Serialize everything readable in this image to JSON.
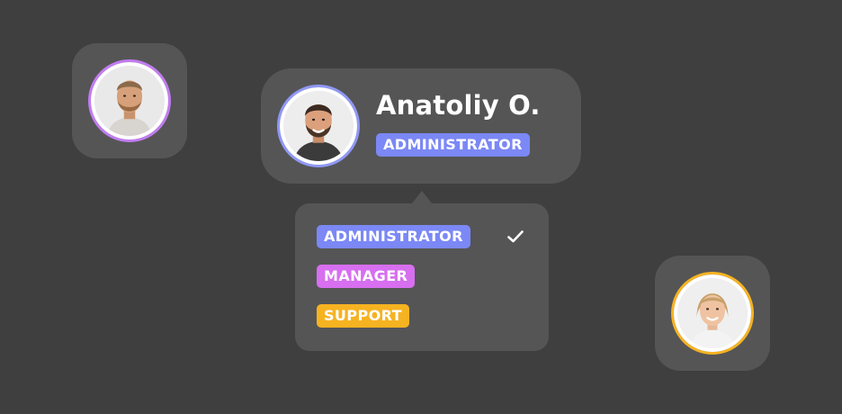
{
  "profile": {
    "name": "Anatoliy O.",
    "role": "ADMINISTRATOR"
  },
  "role_menu": {
    "options": [
      {
        "label": "ADMINISTRATOR",
        "color": "#7b88f5",
        "selected": true
      },
      {
        "label": "MANAGER",
        "color": "#d76ff0",
        "selected": false
      },
      {
        "label": "SUPPORT",
        "color": "#f6b321",
        "selected": false
      }
    ],
    "check_icon": "check-icon"
  },
  "avatars": [
    {
      "name": "avatar-man-beard",
      "ring_color": "#c27cf0"
    },
    {
      "name": "avatar-man-smiling",
      "ring_color": "#8f98f6"
    },
    {
      "name": "avatar-woman-smiling",
      "ring_color": "#f6b321"
    }
  ],
  "colors": {
    "background": "#3f3f40",
    "card": "#555556",
    "administrator": "#7b88f5",
    "manager": "#d76ff0",
    "support": "#f6b321"
  }
}
